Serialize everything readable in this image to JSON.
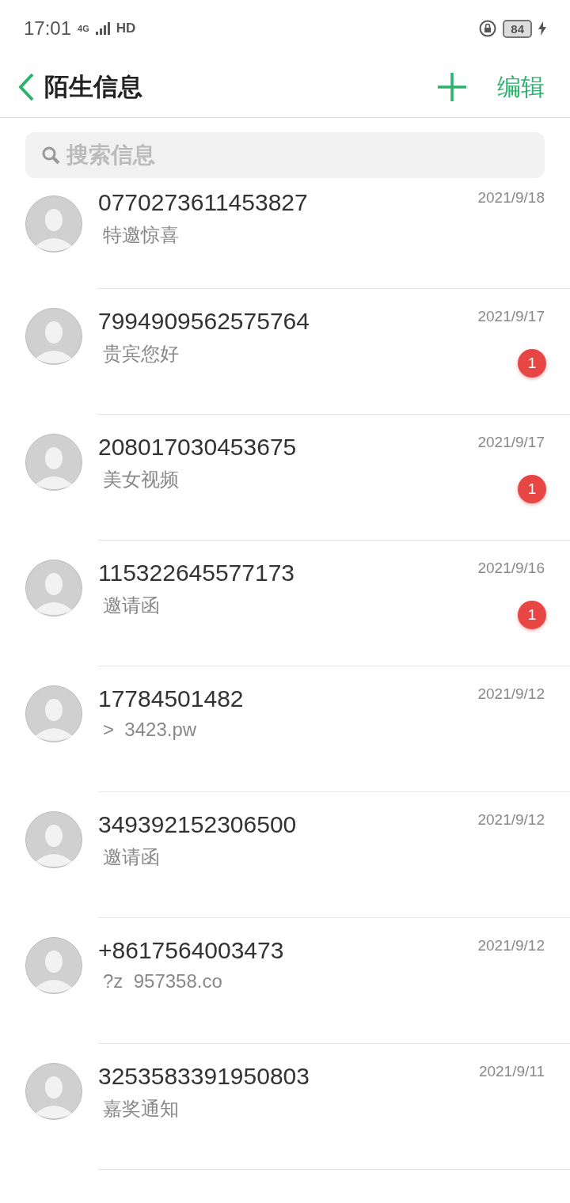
{
  "status_bar": {
    "time": "17:01",
    "network": "4G",
    "hd": "HD",
    "battery": "84",
    "charging": true
  },
  "header": {
    "title": "陌生信息",
    "edit": "编辑"
  },
  "search": {
    "placeholder": "搜索信息"
  },
  "messages": [
    {
      "sender": "0770273611453827",
      "preview": "特邀惊喜",
      "date": "2021/9/18"
    },
    {
      "sender": "7994909562575764",
      "preview": "贵宾您好",
      "date": "2021/9/17",
      "unread": "1"
    },
    {
      "sender": "208017030453675",
      "preview": "美女视频",
      "date": "2021/9/17",
      "unread": "1"
    },
    {
      "sender": "115322645577173",
      "preview": "邀请函",
      "date": "2021/9/16",
      "unread": "1"
    },
    {
      "sender": "17784501482",
      "preview": ">  3423.pw",
      "date": "2021/9/12"
    },
    {
      "sender": "349392152306500",
      "preview": "邀请函",
      "date": "2021/9/12"
    },
    {
      "sender": "+8617564003473",
      "preview": "?z  957358.co",
      "date": "2021/9/12"
    },
    {
      "sender": "3253583391950803",
      "preview": "嘉奖通知",
      "date": "2021/9/11"
    }
  ]
}
